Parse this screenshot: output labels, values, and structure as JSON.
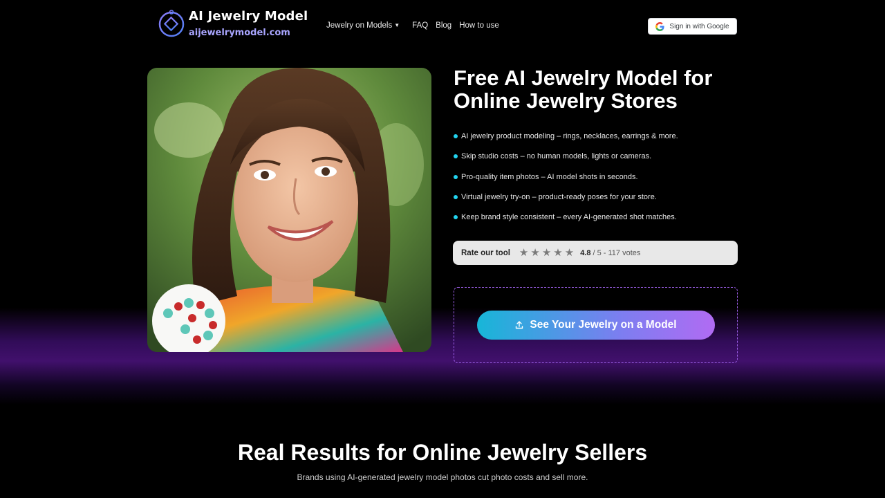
{
  "header": {
    "logo_title": "AI Jewelry Model",
    "logo_domain": "aijewelrymodel.com",
    "nav": [
      {
        "label": "Jewelry on Models",
        "has_dropdown": true
      },
      {
        "label": "FAQ"
      },
      {
        "label": "Blog"
      },
      {
        "label": "How to use"
      }
    ],
    "signin_label": "Sign in with Google"
  },
  "hero": {
    "title": "Free AI Jewelry Model for Online Jewelry Stores",
    "features": [
      "AI jewelry product modeling – rings, necklaces, earrings & more.",
      "Skip studio costs – no human models, lights or cameras.",
      "Pro-quality item photos – AI model shots in seconds.",
      "Virtual jewelry try-on – product-ready poses for your store.",
      "Keep brand style consistent – every AI-generated shot matches."
    ],
    "rating": {
      "label": "Rate our tool",
      "stars": 5,
      "score": "4.8",
      "rest": "/ 5 - 117 votes"
    },
    "cta_label": "See Your Jewelry on a Model",
    "image_icon": "woman-portrait-with-bracelet-image"
  },
  "results": {
    "title": "Real Results for Online Jewelry Sellers",
    "subtitle": "Brands using AI-generated jewelry model photos cut photo costs and sell more."
  },
  "colors": {
    "background": "#000000",
    "accent_cyan": "#22d3ee",
    "accent_purple": "#9b5de5",
    "logo_domain": "#a9a5ff",
    "glow": "#3a0e68"
  }
}
